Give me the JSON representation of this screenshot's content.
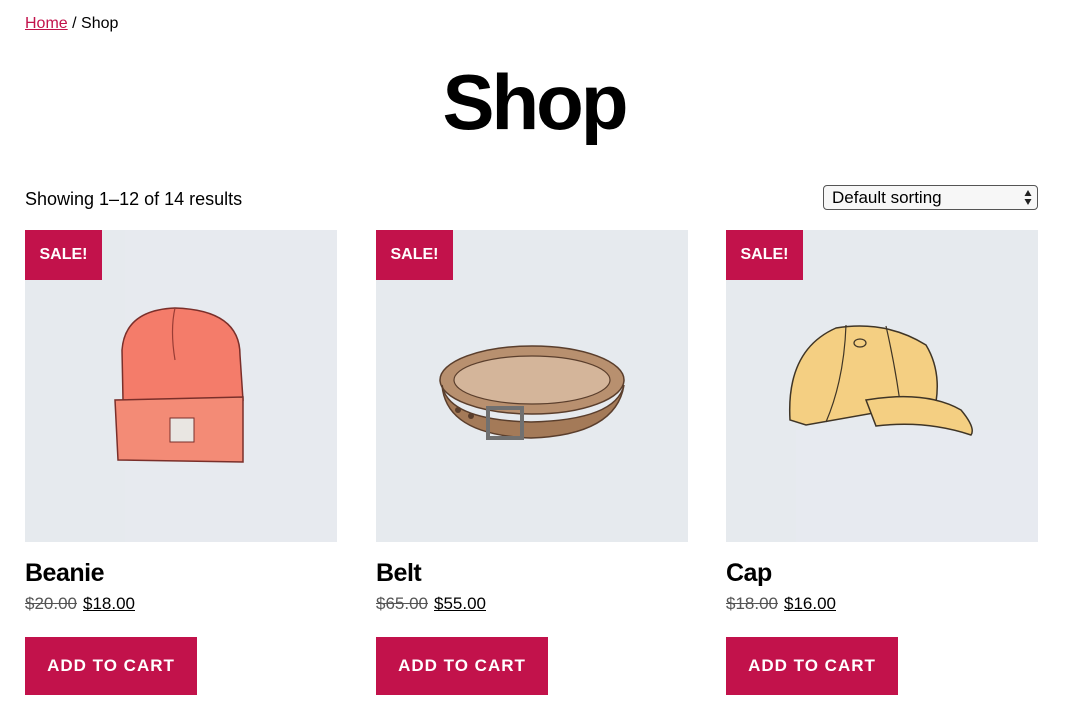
{
  "breadcrumb": {
    "home_label": "Home",
    "separator": "/",
    "current": "Shop"
  },
  "page": {
    "title": "Shop",
    "result_count": "Showing 1–12 of 14 results"
  },
  "sorting": {
    "selected": "Default sorting"
  },
  "colors": {
    "accent": "#c2124b",
    "image_bg": "#e6eaee"
  },
  "products": [
    {
      "name": "Beanie",
      "badge": "SALE!",
      "old_price": "$20.00",
      "price": "$18.00",
      "button": "ADD TO CART",
      "image_icon": "beanie-illustration"
    },
    {
      "name": "Belt",
      "badge": "SALE!",
      "old_price": "$65.00",
      "price": "$55.00",
      "button": "ADD TO CART",
      "image_icon": "belt-illustration"
    },
    {
      "name": "Cap",
      "badge": "SALE!",
      "old_price": "$18.00",
      "price": "$16.00",
      "button": "ADD TO CART",
      "image_icon": "cap-illustration"
    }
  ]
}
